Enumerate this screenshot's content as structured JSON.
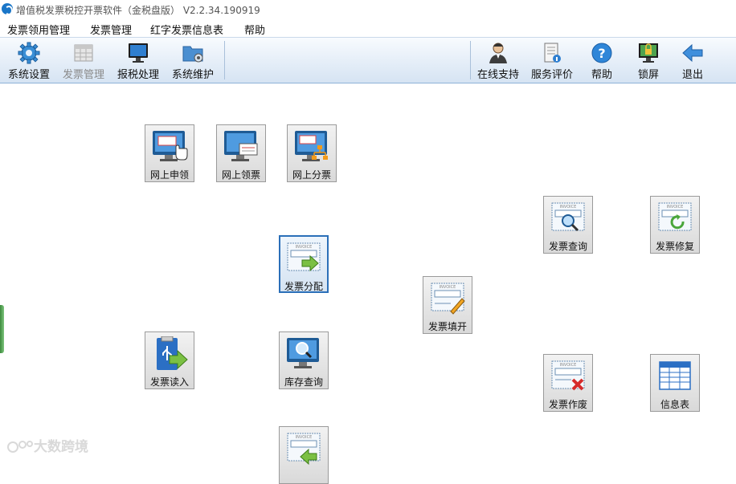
{
  "window": {
    "title": "增值税发票税控开票软件（金税盘版） V2.2.34.190919"
  },
  "menu": [
    {
      "label": "发票领用管理"
    },
    {
      "label": "发票管理"
    },
    {
      "label": "红字发票信息表"
    },
    {
      "label": "帮助"
    }
  ],
  "toolbar": {
    "left": [
      {
        "label": "系统设置",
        "icon": "gear-icon",
        "enabled": true
      },
      {
        "label": "发票管理",
        "icon": "invoice-grid-icon",
        "enabled": false
      },
      {
        "label": "报税处理",
        "icon": "monitor-icon",
        "enabled": true
      },
      {
        "label": "系统维护",
        "icon": "folder-gear-icon",
        "enabled": true
      }
    ],
    "right": [
      {
        "label": "在线支持",
        "icon": "support-person-icon"
      },
      {
        "label": "服务评价",
        "icon": "notebook-info-icon"
      },
      {
        "label": "帮助",
        "icon": "help-icon"
      },
      {
        "label": "锁屏",
        "icon": "lock-screen-icon"
      },
      {
        "label": "退出",
        "icon": "exit-arrow-icon"
      }
    ]
  },
  "tiles": [
    {
      "label": "网上申领",
      "icon": "monitor-hand-icon"
    },
    {
      "label": "网上领票",
      "icon": "monitor-doc-icon"
    },
    {
      "label": "网上分票",
      "icon": "monitor-tree-icon"
    },
    {
      "label": "发票查询",
      "icon": "invoice-search-icon"
    },
    {
      "label": "发票修复",
      "icon": "invoice-repair-icon"
    },
    {
      "label": "发票分配",
      "icon": "invoice-assign-icon"
    },
    {
      "label": "发票填开",
      "icon": "invoice-fill-icon"
    },
    {
      "label": "发票读入",
      "icon": "usb-read-icon"
    },
    {
      "label": "库存查询",
      "icon": "stock-search-icon"
    },
    {
      "label": "发票作废",
      "icon": "invoice-void-icon"
    },
    {
      "label": "信息表",
      "icon": "table-icon"
    },
    {
      "label": "",
      "icon": "invoice-return-icon"
    }
  ],
  "watermark": "大数跨境",
  "colors": {
    "accent": "#2b6fb8",
    "toolbar_border": "#8fb2d8"
  }
}
